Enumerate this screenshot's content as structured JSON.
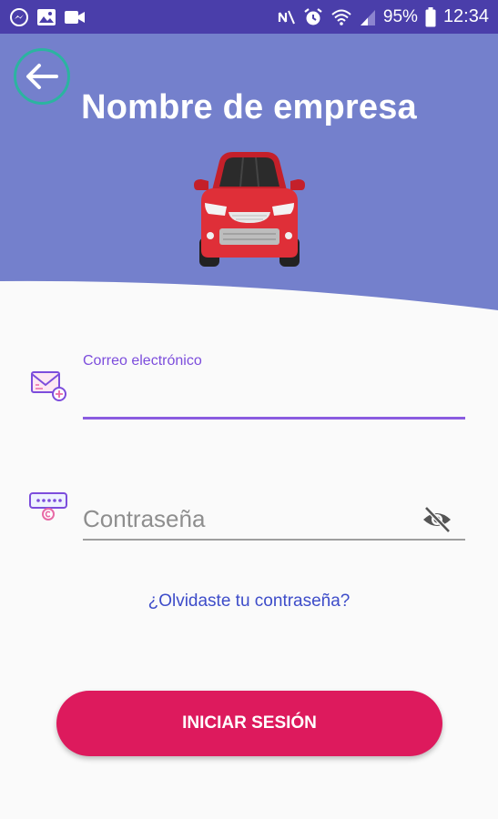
{
  "status_bar": {
    "battery_percent": "95%",
    "time": "12:34",
    "left_icons": [
      "messenger-icon",
      "gallery-icon",
      "video-icon"
    ],
    "right_icons": [
      "nfc-mute-icon",
      "alarm-icon",
      "wifi-icon",
      "signal-icon",
      "battery-icon"
    ]
  },
  "header": {
    "title": "Nombre de empresa",
    "background_color": "#7480cc",
    "back_icon": "arrow-left-icon",
    "logo": "red-car-icon"
  },
  "form": {
    "email": {
      "label": "Correo electrónico",
      "value": "",
      "icon": "email-icon"
    },
    "password": {
      "placeholder": "Contraseña",
      "value": "",
      "icon": "password-icon",
      "toggle_icon": "eye-off-icon"
    },
    "forgot_password": "¿Olvidaste tu contraseña?",
    "submit_label": "INICIAR SESIÓN"
  },
  "colors": {
    "status_bar": "#4a3eaa",
    "accent": "#8a5ce0",
    "button": "#dd1a5d",
    "link": "#3d4cc9",
    "back_ring": "#2bb4a0"
  }
}
